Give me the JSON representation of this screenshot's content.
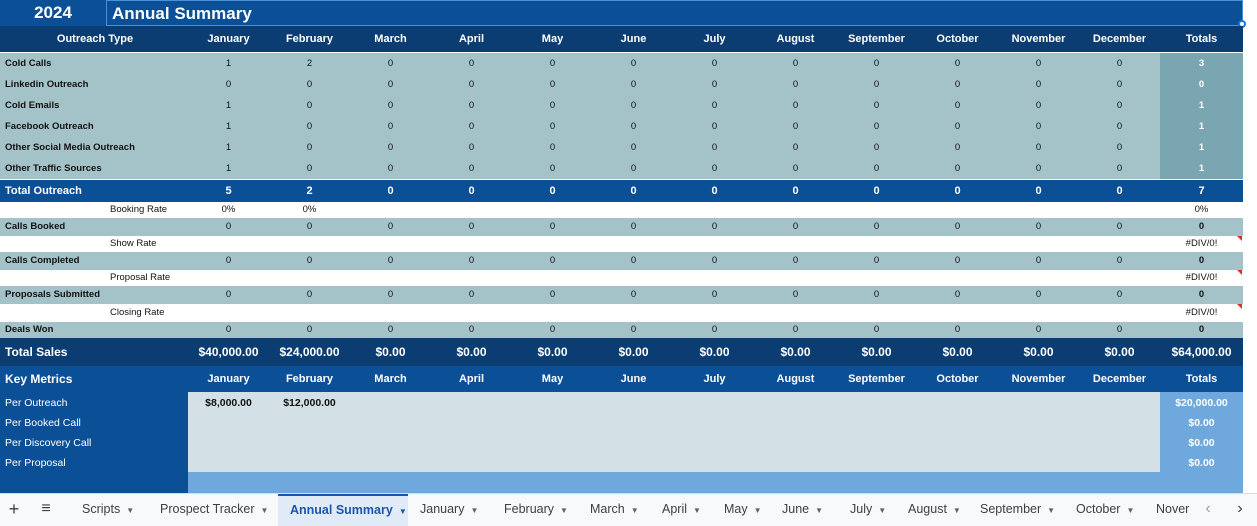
{
  "title_bar": {
    "year": "2024",
    "title": "Annual Summary"
  },
  "months": [
    "January",
    "February",
    "March",
    "April",
    "May",
    "June",
    "July",
    "August",
    "September",
    "October",
    "November",
    "December"
  ],
  "header": {
    "outreach_type": "Outreach Type",
    "totals": "Totals"
  },
  "outreach_rows": [
    {
      "label": "Cold Calls",
      "values": [
        "1",
        "2",
        "0",
        "0",
        "0",
        "0",
        "0",
        "0",
        "0",
        "0",
        "0",
        "0"
      ],
      "total": "3"
    },
    {
      "label": "Linkedin Outreach",
      "values": [
        "0",
        "0",
        "0",
        "0",
        "0",
        "0",
        "0",
        "0",
        "0",
        "0",
        "0",
        "0"
      ],
      "total": "0"
    },
    {
      "label": "Cold Emails",
      "values": [
        "1",
        "0",
        "0",
        "0",
        "0",
        "0",
        "0",
        "0",
        "0",
        "0",
        "0",
        "0"
      ],
      "total": "1"
    },
    {
      "label": "Facebook Outreach",
      "values": [
        "1",
        "0",
        "0",
        "0",
        "0",
        "0",
        "0",
        "0",
        "0",
        "0",
        "0",
        "0"
      ],
      "total": "1"
    },
    {
      "label": "Other Social Media Outreach",
      "values": [
        "1",
        "0",
        "0",
        "0",
        "0",
        "0",
        "0",
        "0",
        "0",
        "0",
        "0",
        "0"
      ],
      "total": "1"
    },
    {
      "label": "Other Traffic Sources",
      "values": [
        "1",
        "0",
        "0",
        "0",
        "0",
        "0",
        "0",
        "0",
        "0",
        "0",
        "0",
        "0"
      ],
      "total": "1"
    }
  ],
  "total_outreach": {
    "label": "Total Outreach",
    "values": [
      "5",
      "2",
      "0",
      "0",
      "0",
      "0",
      "0",
      "0",
      "0",
      "0",
      "0",
      "0"
    ],
    "total": "7"
  },
  "funnel": [
    {
      "kind": "rate",
      "label": "Booking Rate",
      "values": [
        "0%",
        "0%",
        "",
        "",
        "",
        "",
        "",
        "",
        "",
        "",
        "",
        ""
      ],
      "total": "0%",
      "flag": false
    },
    {
      "kind": "stage",
      "label": "Calls Booked",
      "values": [
        "0",
        "0",
        "0",
        "0",
        "0",
        "0",
        "0",
        "0",
        "0",
        "0",
        "0",
        "0"
      ],
      "total": "0"
    },
    {
      "kind": "rate",
      "label": "Show Rate",
      "values": [
        "",
        "",
        "",
        "",
        "",
        "",
        "",
        "",
        "",
        "",
        "",
        ""
      ],
      "total": "#DIV/0!",
      "flag": true
    },
    {
      "kind": "stage",
      "label": "Calls Completed",
      "values": [
        "0",
        "0",
        "0",
        "0",
        "0",
        "0",
        "0",
        "0",
        "0",
        "0",
        "0",
        "0"
      ],
      "total": "0"
    },
    {
      "kind": "rate",
      "label": "Proposal Rate",
      "values": [
        "",
        "",
        "",
        "",
        "",
        "",
        "",
        "",
        "",
        "",
        "",
        ""
      ],
      "total": "#DIV/0!",
      "flag": true
    },
    {
      "kind": "stage",
      "label": "Proposals Submitted",
      "values": [
        "0",
        "0",
        "0",
        "0",
        "0",
        "0",
        "0",
        "0",
        "0",
        "0",
        "0",
        "0"
      ],
      "total": "0"
    },
    {
      "kind": "rate",
      "label": "Closing Rate",
      "values": [
        "",
        "",
        "",
        "",
        "",
        "",
        "",
        "",
        "",
        "",
        "",
        ""
      ],
      "total": "#DIV/0!",
      "flag": true
    },
    {
      "kind": "stage",
      "label": "Deals Won",
      "values": [
        "0",
        "0",
        "0",
        "0",
        "0",
        "0",
        "0",
        "0",
        "0",
        "0",
        "0",
        "0"
      ],
      "total": "0"
    }
  ],
  "total_sales": {
    "label": "Total Sales",
    "values": [
      "$40,000.00",
      "$24,000.00",
      "$0.00",
      "$0.00",
      "$0.00",
      "$0.00",
      "$0.00",
      "$0.00",
      "$0.00",
      "$0.00",
      "$0.00",
      "$0.00"
    ],
    "total": "$64,000.00"
  },
  "key_metrics": {
    "label": "Key Metrics",
    "rows": [
      {
        "label": "Per Outreach",
        "values": [
          "$8,000.00",
          "$12,000.00",
          "",
          "",
          "",
          "",
          "",
          "",
          "",
          "",
          "",
          ""
        ],
        "total": "$20,000.00"
      },
      {
        "label": "Per Booked Call",
        "values": [
          "",
          "",
          "",
          "",
          "",
          "",
          "",
          "",
          "",
          "",
          "",
          ""
        ],
        "total": "$0.00"
      },
      {
        "label": "Per Discovery Call",
        "values": [
          "",
          "",
          "",
          "",
          "",
          "",
          "",
          "",
          "",
          "",
          "",
          ""
        ],
        "total": "$0.00"
      },
      {
        "label": "Per Proposal",
        "values": [
          "",
          "",
          "",
          "",
          "",
          "",
          "",
          "",
          "",
          "",
          "",
          ""
        ],
        "total": "$0.00"
      }
    ]
  },
  "colors": {
    "title_blue": "#0b4f96",
    "header_navy": "#0b3d73",
    "teal_row": "#a4c3c8",
    "totals_col": "#7aa6b2",
    "metrics_body": "#d3e1e6",
    "metrics_totals": "#6fa8dc"
  },
  "sheet_tabs": {
    "add_icon": "plus-icon",
    "menu_icon": "hamburger-menu-icon",
    "tabs": [
      "Scripts",
      "Prospect Tracker",
      "Annual Summary",
      "January",
      "February",
      "March",
      "April",
      "May",
      "June",
      "July",
      "August",
      "September",
      "October",
      "Nover"
    ],
    "active": "Annual Summary"
  }
}
